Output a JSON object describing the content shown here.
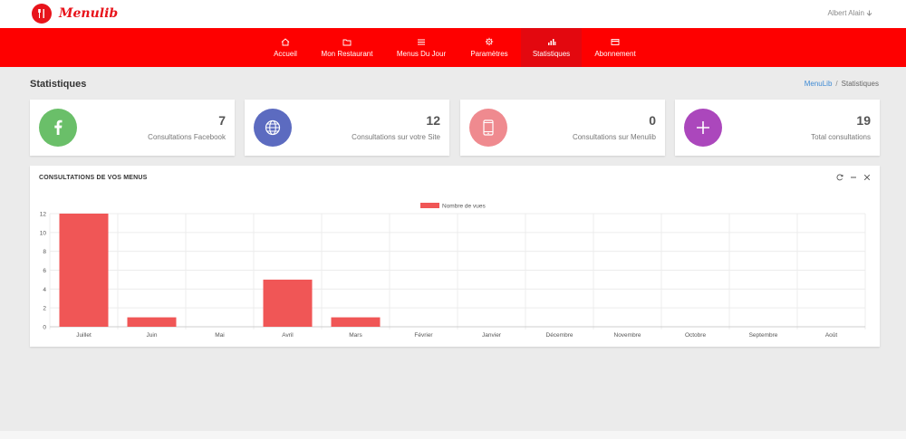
{
  "app": {
    "name": "Menulib",
    "user": "Albert Alain"
  },
  "nav": [
    {
      "label": "Accueil",
      "icon": "home-icon",
      "active": false
    },
    {
      "label": "Mon Restaurant",
      "icon": "folder-icon",
      "active": false
    },
    {
      "label": "Menus Du Jour",
      "icon": "menu-icon",
      "active": false
    },
    {
      "label": "Paramètres",
      "icon": "gear-icon",
      "active": false
    },
    {
      "label": "Statistiques",
      "icon": "bar-chart-icon",
      "active": true
    },
    {
      "label": "Abonnement",
      "icon": "card-icon",
      "active": false
    }
  ],
  "page": {
    "title": "Statistiques",
    "breadcrumb": [
      "MenuLib",
      "Statistiques"
    ]
  },
  "stats": [
    {
      "value": "7",
      "label": "Consultations Facebook",
      "icon": "facebook-icon",
      "color": "#6abf69"
    },
    {
      "value": "12",
      "label": "Consultations sur votre Site",
      "icon": "globe-icon",
      "color": "#5c6bc0"
    },
    {
      "value": "0",
      "label": "Consultations sur Menulib",
      "icon": "phone-icon",
      "color": "#ef8a8f"
    },
    {
      "value": "19",
      "label": "Total consultations",
      "icon": "plus-icon",
      "color": "#ab47bc"
    }
  ],
  "panel": {
    "title": "CONSULTATIONS DE VOS MENUS"
  },
  "colors": {
    "brand": "#fe0000",
    "bar": "#f05656"
  },
  "chart_data": {
    "type": "bar",
    "categories": [
      "Juillet",
      "Juin",
      "Mai",
      "Avril",
      "Mars",
      "Février",
      "Janvier",
      "Décembre",
      "Novembre",
      "Octobre",
      "Septembre",
      "Août"
    ],
    "series": [
      {
        "name": "Nombre de vues",
        "values": [
          12,
          1,
          0,
          5,
          1,
          0,
          0,
          0,
          0,
          0,
          0,
          0
        ]
      }
    ],
    "y_ticks": [
      "0",
      "2",
      "4",
      "6",
      "8",
      "10",
      "12"
    ],
    "ylim": [
      0,
      12
    ],
    "legend": "top-center",
    "grid": true
  }
}
